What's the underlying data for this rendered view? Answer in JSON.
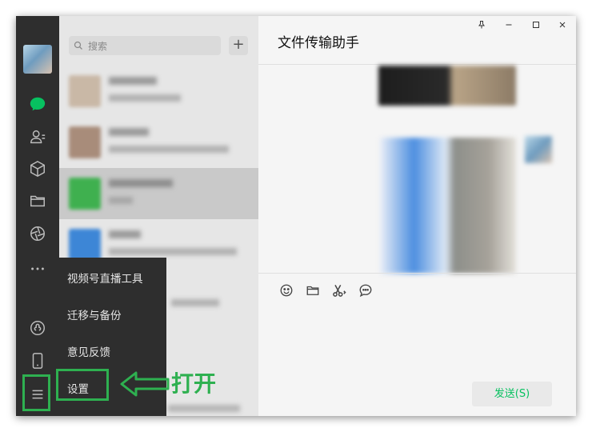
{
  "window": {
    "title": "文件传输助手",
    "controls": [
      "pin-icon",
      "minimize-icon",
      "maximize-icon",
      "close-icon"
    ]
  },
  "rail": {
    "icons": [
      "avatar",
      "chat-icon",
      "contacts-icon",
      "favorites-cube-icon",
      "folder-icon",
      "moments-aperture-icon",
      "more-dots-icon",
      "mini-program-icon",
      "phone-icon",
      "menu-hamburger-icon"
    ],
    "accent_color": "#07c160"
  },
  "search": {
    "placeholder": "搜索"
  },
  "menu": {
    "items": [
      "视频号直播工具",
      "迁移与备份",
      "意见反馈",
      "设置"
    ]
  },
  "annotation": {
    "text": "打开",
    "color": "#2eb050"
  },
  "toolbar": {
    "icons": [
      "emoji-icon",
      "folder-icon",
      "scissors-icon",
      "chat-bubble-icon"
    ]
  },
  "send_button": {
    "label": "发送(S)"
  }
}
